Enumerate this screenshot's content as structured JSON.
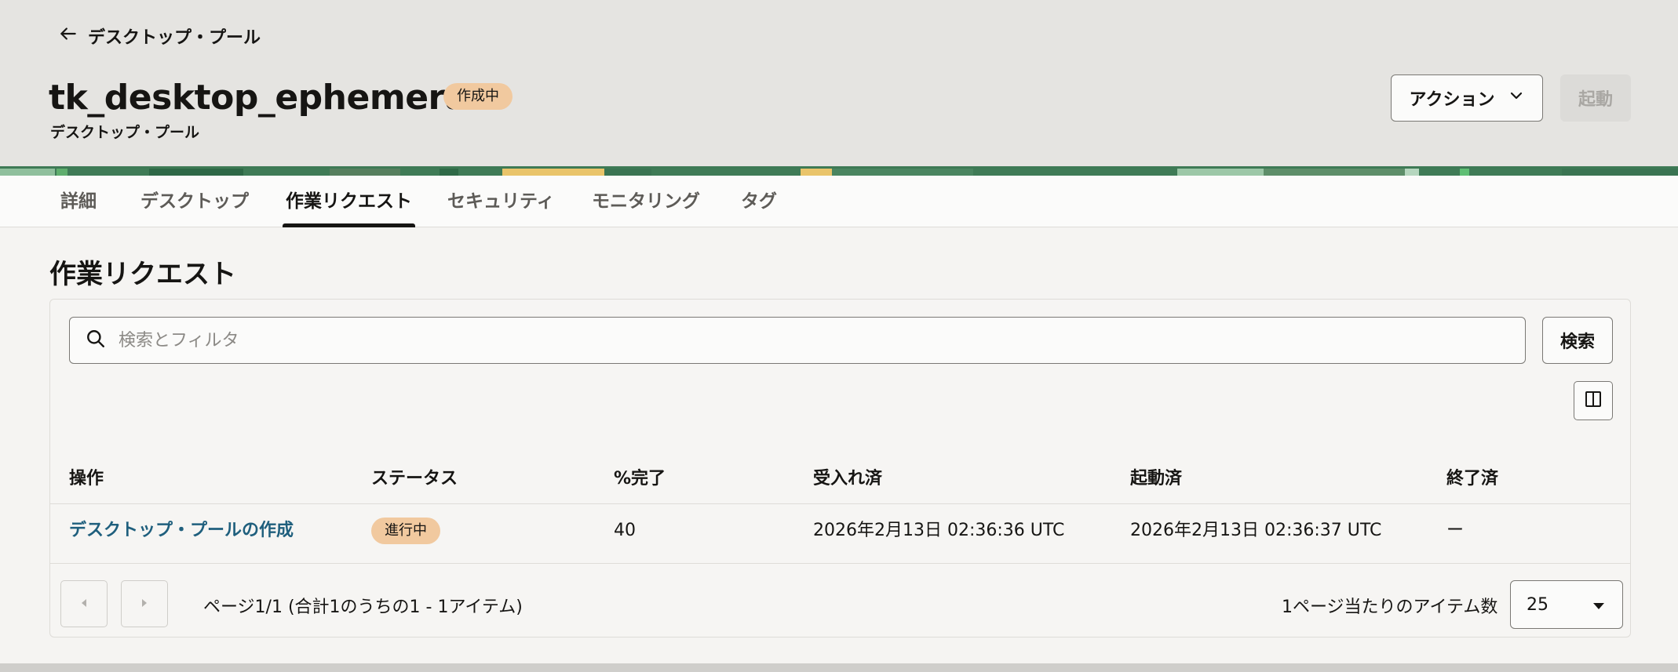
{
  "header": {
    "back_label": "デスクトップ・プール",
    "title": "tk_desktop_ephemeral",
    "state_badge": "作成中",
    "subtitle": "デスクトップ・プール",
    "actions_label": "アクション",
    "start_label": "起動"
  },
  "tabs": [
    {
      "label": "詳細"
    },
    {
      "label": "デスクトップ"
    },
    {
      "label": "作業リクエスト",
      "active": true
    },
    {
      "label": "セキュリティ"
    },
    {
      "label": "モニタリング"
    },
    {
      "label": "タグ"
    }
  ],
  "section": {
    "title": "作業リクエスト"
  },
  "search": {
    "placeholder": "検索とフィルタ",
    "button_label": "検索"
  },
  "table": {
    "columns": [
      "操作",
      "ステータス",
      "%完了",
      "受入れ済",
      "起動済",
      "終了済"
    ],
    "rows": [
      {
        "operation": "デスクトップ・プールの作成",
        "status": "進行中",
        "percent_complete": "40",
        "accepted": "2026年2月13日 02:36:36 UTC",
        "started": "2026年2月13日 02:36:37 UTC",
        "finished": "ー"
      }
    ]
  },
  "pagination": {
    "summary": "ページ1/1 (合計1のうちの1 - 1アイテム)",
    "per_page_label": "1ページ当たりのアイテム数",
    "per_page_value": "25"
  },
  "colors": {
    "accent_link": "#1f5f7d",
    "badge_bg": "#f1c99f",
    "header_bg": "#e5e4e1"
  },
  "icons": [
    "arrow-left-icon",
    "chevron-down-icon",
    "search-icon",
    "columns-icon",
    "chevron-left-icon",
    "chevron-right-icon",
    "caret-down-icon"
  ]
}
